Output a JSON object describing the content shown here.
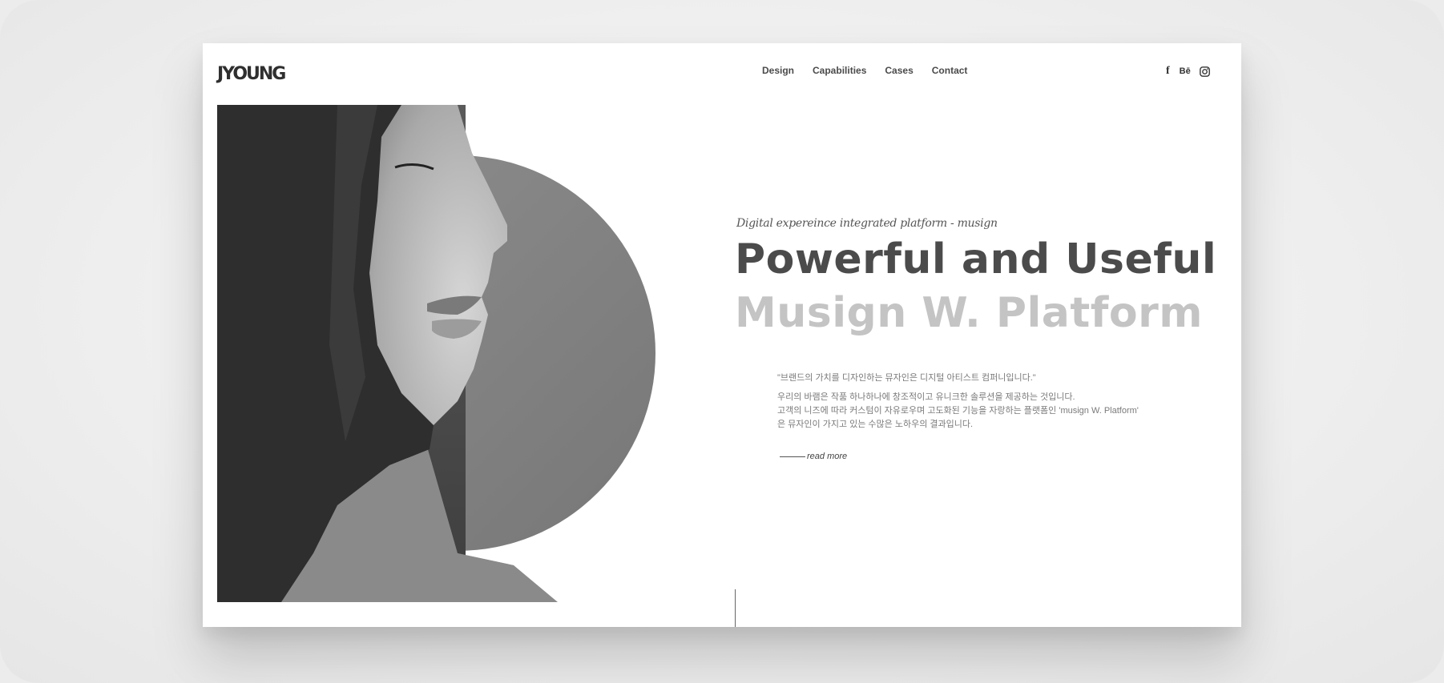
{
  "brand": {
    "logo": "JYOUNG"
  },
  "nav": {
    "items": [
      "Design",
      "Capabilities",
      "Cases",
      "Contact"
    ]
  },
  "social": {
    "facebook": "f",
    "behance": "Bē",
    "instagram_icon": "instagram-icon"
  },
  "hero": {
    "tagline": "Digital expereince integrated platform - musign",
    "title_line1": "Powerful and Useful",
    "title_line2": "Musign W. Platform",
    "quote": "\"브랜드의 가치를 디자인하는 뮤자인은 디지털 아티스트 컴퍼니입니다.\"",
    "paragraph": [
      "우리의 바램은 작품 하나하나에 창조적이고 유니크한 솔루션을 제공하는 것입니다.",
      "고객의 니즈에 따라 커스텀이 자유로우며 고도화된 기능을 자랑하는 플랫폼인 'musign W. Platform'",
      "은 뮤자인이 가지고 있는 수많은 노하우의 결과입니다."
    ],
    "read_more": "read more"
  },
  "colors": {
    "background": "#efefef",
    "card": "#ffffff",
    "title_dark": "#4b4b4b",
    "title_light": "#c4c4c4",
    "body_text": "#7a7a7a"
  }
}
